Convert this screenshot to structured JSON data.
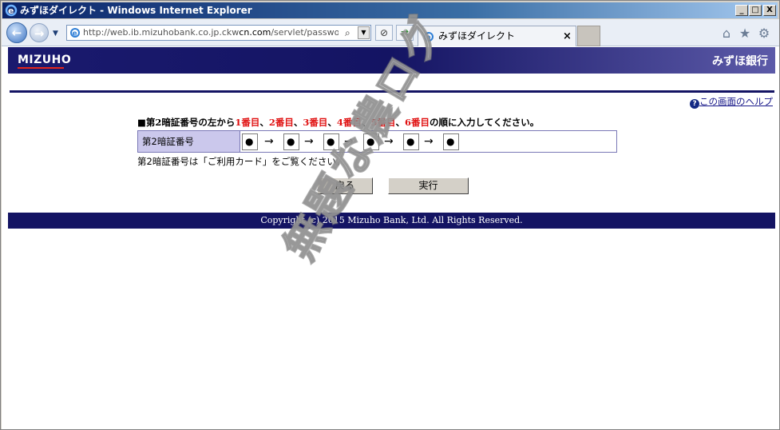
{
  "window": {
    "title": "みずほダイレクト - Windows Internet Explorer",
    "minimize": "_",
    "maximize": "□",
    "close": "X"
  },
  "navbar": {
    "back_glyph": "←",
    "forward_glyph": "→",
    "history_glyph": "▼",
    "url_prefix": "http://web.ib.mizuhobank.co.jp.ckw",
    "url_domain": "cn.com",
    "url_suffix": "/servlet/password.htm",
    "search_glyph": "⌕",
    "dropdown_glyph": "▼",
    "stop_glyph": "⊘",
    "refresh_glyph": "⇄",
    "tab_label": "みずほダイレクト",
    "tab_close": "×",
    "home_glyph": "⌂",
    "favorites_glyph": "★",
    "tools_glyph": "⚙"
  },
  "page": {
    "logo": "MIZUHO",
    "brand_name": "みずほ銀行",
    "help_q": "?",
    "help_text": "この画面のヘルプ",
    "instruction": {
      "prefix": "■第2暗証番号の左から",
      "items": [
        "1番目",
        "2番目",
        "3番目",
        "4番目",
        "5番目",
        "6番目"
      ],
      "separator": "、",
      "suffix": "の順に入力してください。"
    },
    "form": {
      "label": "第2暗証番号",
      "values": [
        "●",
        "●",
        "●",
        "●",
        "●",
        "●"
      ],
      "arrow": "→"
    },
    "note": "第2暗証番号は「ご利用カード」をご覧ください。",
    "back_button": "戻る",
    "execute_button": "実行",
    "footer": "Copyright (c) 2015 Mizuho Bank, Ltd. All Rights Reserved.",
    "watermark": "無題な農ログ"
  },
  "colors": {
    "brand_navy": "#141463",
    "label_bg": "#cbc8ec",
    "highlight_red": "#e01010"
  }
}
